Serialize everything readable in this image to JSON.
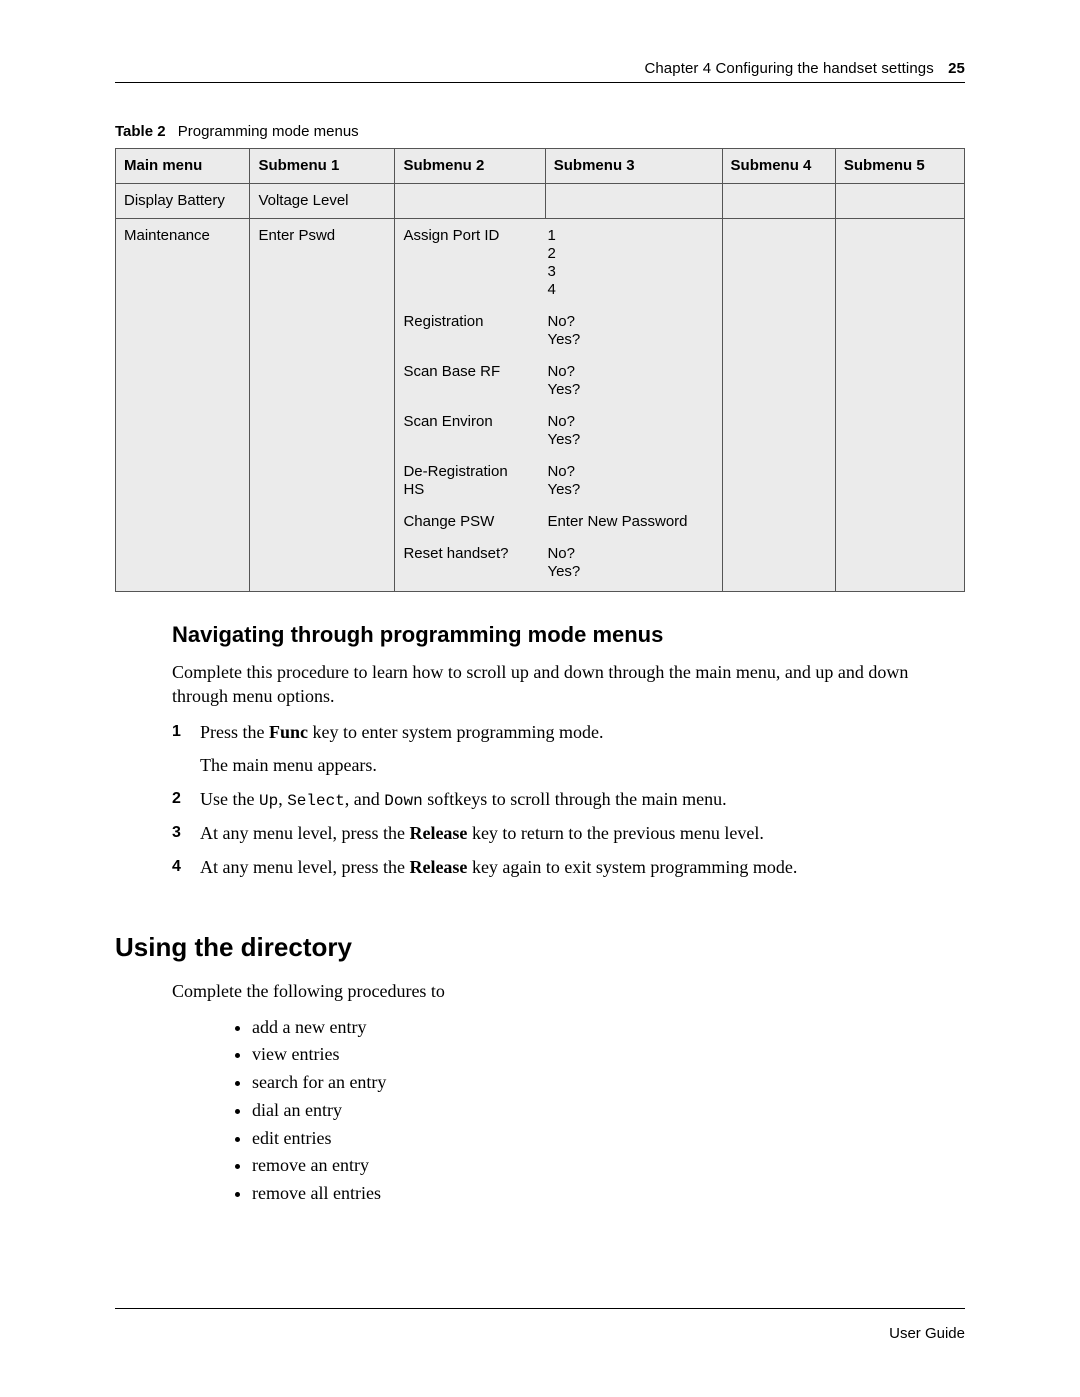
{
  "header": {
    "chapter_label": "Chapter 4  Configuring the handset settings",
    "page_number": "25"
  },
  "table_caption": {
    "label": "Table 2",
    "text": "Programming mode menus"
  },
  "table": {
    "headers": [
      "Main menu",
      "Submenu 1",
      "Submenu 2",
      "Submenu 3",
      "Submenu 4",
      "Submenu 5"
    ],
    "row1": {
      "main": "Display Battery",
      "sm1": "Voltage Level",
      "sm2": "",
      "sm3": "",
      "sm4": "",
      "sm5": ""
    },
    "row2": {
      "main": "Maintenance",
      "sm1": "Enter Pswd",
      "items": [
        {
          "sm2": "Assign Port ID",
          "sm3": "1\n2\n3\n4"
        },
        {
          "sm2": "Registration",
          "sm3": "No?\nYes?"
        },
        {
          "sm2": "Scan Base RF",
          "sm3": "No?\nYes?"
        },
        {
          "sm2": "Scan Environ",
          "sm3": "No?\nYes?"
        },
        {
          "sm2": "De-Registration HS",
          "sm3": "No?\nYes?"
        },
        {
          "sm2": "Change PSW",
          "sm3": "Enter New Password"
        },
        {
          "sm2": "Reset handset?",
          "sm3": "No?\nYes?"
        }
      ]
    }
  },
  "section1": {
    "title": "Navigating through programming mode menus",
    "intro": "Complete this procedure to learn how to scroll up and down through the main menu, and up and down through menu options.",
    "steps": {
      "s1": {
        "num": "1",
        "p1_pre": "Press the ",
        "p1_bold": "Func",
        "p1_post": " key to enter system programming mode.",
        "p2": "The main menu appears."
      },
      "s2": {
        "num": "2",
        "p_pre": "Use the ",
        "k1": "Up",
        "sep1": ", ",
        "k2": "Select",
        "sep2": ", and ",
        "k3": "Down",
        "p_post": " softkeys to scroll through the main menu."
      },
      "s3": {
        "num": "3",
        "p_pre": "At any menu level, press the ",
        "p_bold": "Release",
        "p_post": " key to return to the previous menu level."
      },
      "s4": {
        "num": "4",
        "p_pre": "At any menu level, press the ",
        "p_bold": "Release",
        "p_post": " key again to exit system programming mode."
      }
    }
  },
  "section2": {
    "title": "Using the directory",
    "intro": "Complete the following procedures to",
    "bullets": [
      "add a new entry",
      "view entries",
      "search for an entry",
      "dial an entry",
      "edit entries",
      "remove an entry",
      "remove all entries"
    ]
  },
  "footer": {
    "label": "User Guide"
  },
  "chart_data": {
    "type": "table",
    "title": "Programming mode menus",
    "columns": [
      "Main menu",
      "Submenu 1",
      "Submenu 2",
      "Submenu 3",
      "Submenu 4",
      "Submenu 5"
    ],
    "rows": [
      [
        "Display Battery",
        "Voltage Level",
        "",
        "",
        "",
        ""
      ],
      [
        "Maintenance",
        "Enter Pswd",
        "Assign Port ID",
        "1 / 2 / 3 / 4",
        "",
        ""
      ],
      [
        "Maintenance",
        "Enter Pswd",
        "Registration",
        "No? / Yes?",
        "",
        ""
      ],
      [
        "Maintenance",
        "Enter Pswd",
        "Scan Base RF",
        "No? / Yes?",
        "",
        ""
      ],
      [
        "Maintenance",
        "Enter Pswd",
        "Scan Environ",
        "No? / Yes?",
        "",
        ""
      ],
      [
        "Maintenance",
        "Enter Pswd",
        "De-Registration HS",
        "No? / Yes?",
        "",
        ""
      ],
      [
        "Maintenance",
        "Enter Pswd",
        "Change PSW",
        "Enter New Password",
        "",
        ""
      ],
      [
        "Maintenance",
        "Enter Pswd",
        "Reset handset?",
        "No? / Yes?",
        "",
        ""
      ]
    ]
  }
}
